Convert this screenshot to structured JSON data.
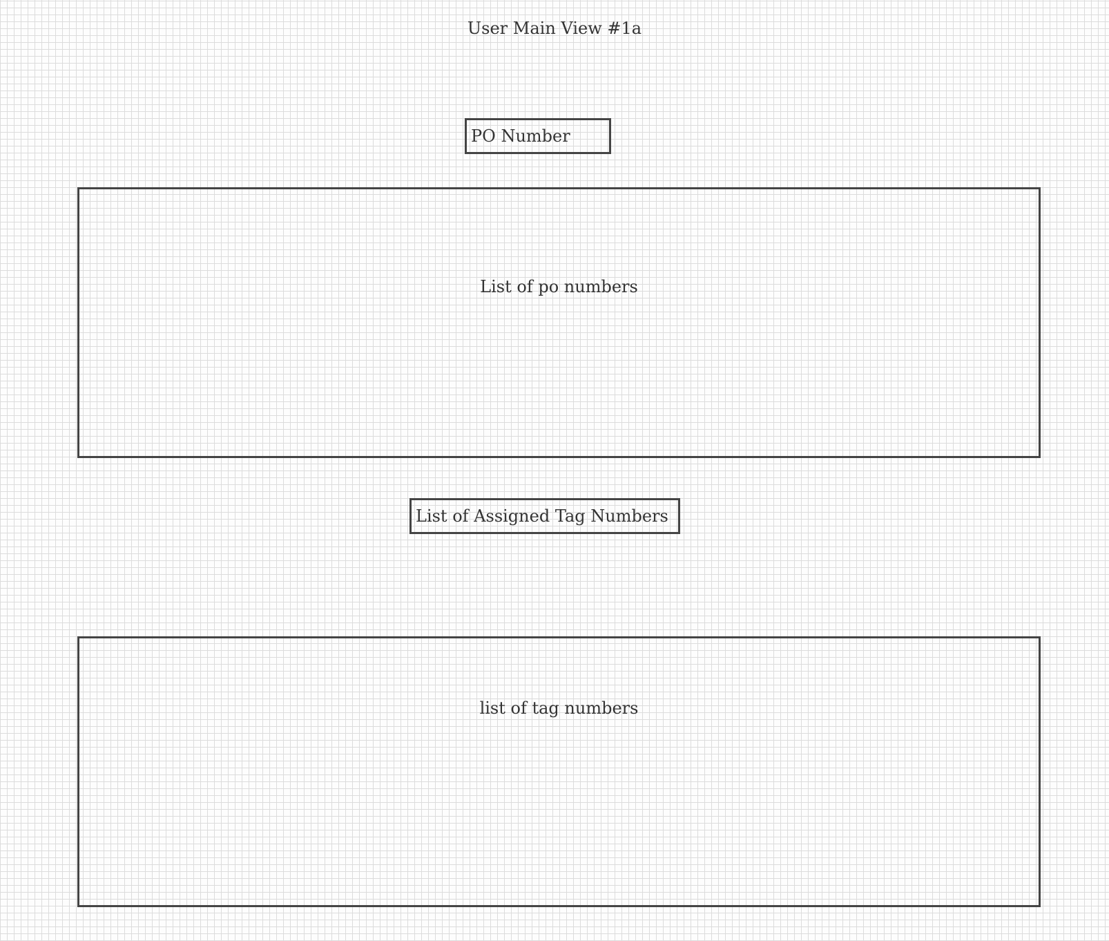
{
  "page": {
    "title": "User Main View #1a"
  },
  "po_number": {
    "label": "PO Number"
  },
  "po_list": {
    "label": "List of po numbers"
  },
  "tag_section": {
    "label": "List of Assigned Tag Numbers"
  },
  "tag_list": {
    "label": "list of tag numbers"
  },
  "colors": {
    "border": "#444444",
    "text": "#333333",
    "grid": "#dcdcdc"
  }
}
